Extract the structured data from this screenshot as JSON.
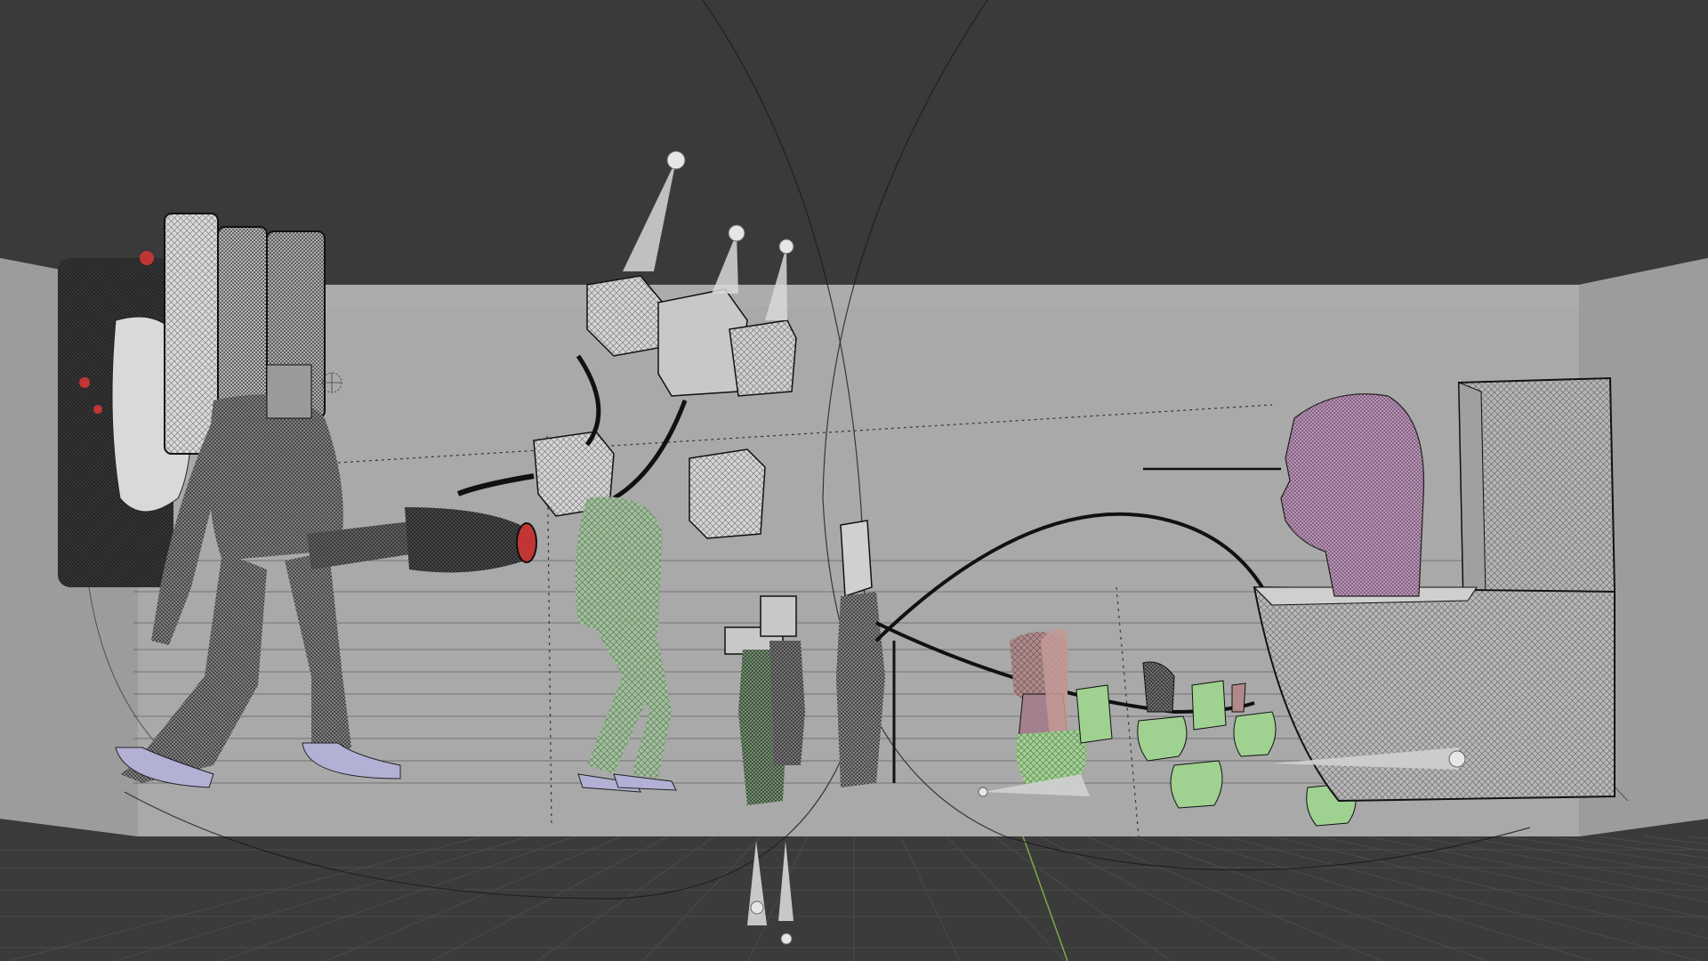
{
  "viewport": {
    "mode": "wireframe-overlay",
    "background_color": "#3a3a3a",
    "backdrop_color": "#a9a9a9",
    "floor_color": "#3b3b3b",
    "grid_color": "#4a4a4a",
    "y_axis_color": "#7fa84a",
    "wire_color": "#1c1c1c"
  },
  "objects": [
    {
      "name": "titan-speakerman",
      "fill": "#aeb0b6",
      "accent": "#b3b0d6",
      "highlight": "#c23535"
    },
    {
      "name": "tv-head-character",
      "fill": "#9fbf9a"
    },
    {
      "name": "small-cameraman-left",
      "fill": "#7c9c78"
    },
    {
      "name": "small-cameraman-right",
      "fill": "#7f7f7f"
    },
    {
      "name": "cameraman-with-stick",
      "fill": "#8c8c8c"
    },
    {
      "name": "toilet-group-left",
      "fill": "#9fd191",
      "head_fill": "#b08a8a"
    },
    {
      "name": "toilet-group-middle",
      "fill": "#9fd191"
    },
    {
      "name": "giant-toilet",
      "fill": "#b5b5b5"
    },
    {
      "name": "giant-head",
      "fill": "#c79bc4"
    }
  ],
  "lights": [
    {
      "name": "spot-light-top-left"
    },
    {
      "name": "spot-light-top-middle"
    },
    {
      "name": "spot-light-top-right"
    },
    {
      "name": "spot-light-bottom"
    }
  ]
}
